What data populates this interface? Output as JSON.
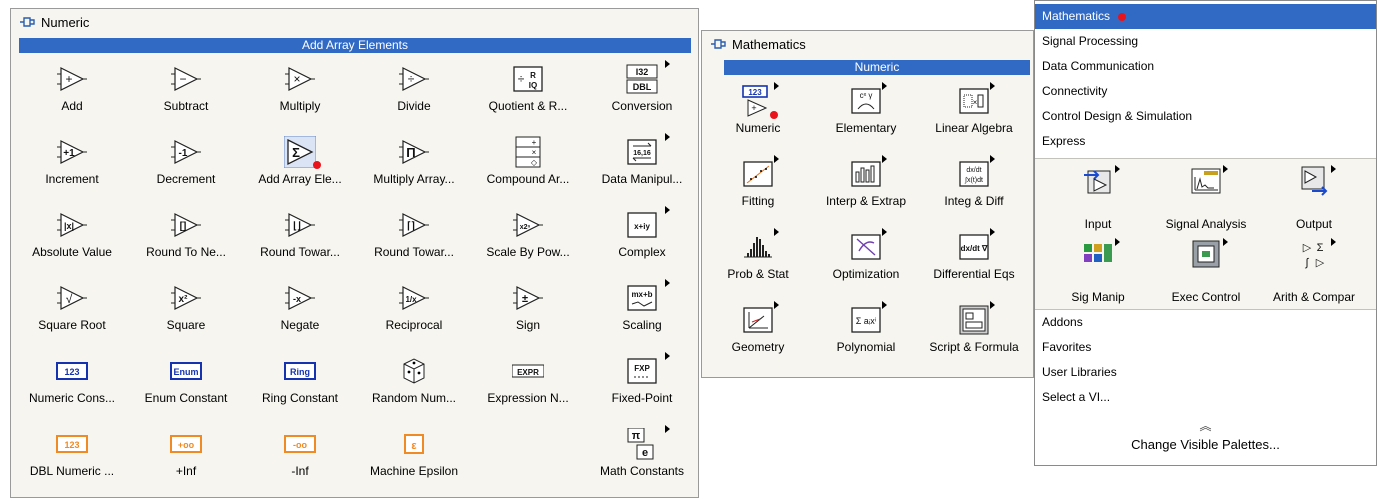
{
  "numeric_palette": {
    "title": "Numeric",
    "selected": "Add Array Elements",
    "items": [
      {
        "label": "Add",
        "icon": "add-icon"
      },
      {
        "label": "Subtract",
        "icon": "subtract-icon"
      },
      {
        "label": "Multiply",
        "icon": "multiply-icon"
      },
      {
        "label": "Divide",
        "icon": "divide-icon"
      },
      {
        "label": "Quotient & R...",
        "icon": "quotient-remainder-icon"
      },
      {
        "label": "Conversion",
        "icon": "conversion-icon"
      },
      {
        "label": "Increment",
        "icon": "increment-icon"
      },
      {
        "label": "Decrement",
        "icon": "decrement-icon"
      },
      {
        "label": "Add Array Ele...",
        "icon": "add-array-elements-icon"
      },
      {
        "label": "Multiply Array...",
        "icon": "multiply-array-icon"
      },
      {
        "label": "Compound Ar...",
        "icon": "compound-arithmetic-icon"
      },
      {
        "label": "Data Manipul...",
        "icon": "data-manipulation-icon"
      },
      {
        "label": "Absolute Value",
        "icon": "absolute-value-icon"
      },
      {
        "label": "Round To Ne...",
        "icon": "round-nearest-icon"
      },
      {
        "label": "Round Towar...",
        "icon": "round-down-icon"
      },
      {
        "label": "Round Towar...",
        "icon": "round-up-icon"
      },
      {
        "label": "Scale By Pow...",
        "icon": "scale-power-icon"
      },
      {
        "label": "Complex",
        "icon": "complex-icon"
      },
      {
        "label": "Square Root",
        "icon": "square-root-icon"
      },
      {
        "label": "Square",
        "icon": "square-icon"
      },
      {
        "label": "Negate",
        "icon": "negate-icon"
      },
      {
        "label": "Reciprocal",
        "icon": "reciprocal-icon"
      },
      {
        "label": "Sign",
        "icon": "sign-icon"
      },
      {
        "label": "Scaling",
        "icon": "scaling-icon"
      },
      {
        "label": "Numeric Cons...",
        "icon": "numeric-constant-icon"
      },
      {
        "label": "Enum Constant",
        "icon": "enum-constant-icon"
      },
      {
        "label": "Ring Constant",
        "icon": "ring-constant-icon"
      },
      {
        "label": "Random Num...",
        "icon": "random-number-icon"
      },
      {
        "label": "Expression N...",
        "icon": "expression-node-icon"
      },
      {
        "label": "Fixed-Point",
        "icon": "fixed-point-icon"
      },
      {
        "label": "DBL Numeric ...",
        "icon": "dbl-numeric-constant-icon"
      },
      {
        "label": "+Inf",
        "icon": "plus-inf-icon"
      },
      {
        "label": "-Inf",
        "icon": "minus-inf-icon"
      },
      {
        "label": "Machine Epsilon",
        "icon": "machine-epsilon-icon"
      },
      {
        "label": "",
        "icon": "empty"
      },
      {
        "label": "Math Constants",
        "icon": "math-constants-icon"
      }
    ],
    "icon_text": {
      "quotient": "R\nIQ",
      "conv_top": "I32",
      "conv_bot": "DBL",
      "manip": "16,16",
      "complex": "x+iy",
      "scaling_top": "mx+b",
      "numconst": "123",
      "enumconst": "Enum",
      "ringconst": "Ring",
      "expr": "EXPR",
      "fxp": "FXP",
      "dbl": "123",
      "pinf": "+oo",
      "minf": "-oo",
      "eps": "ε",
      "pi": "π",
      "e": "e"
    }
  },
  "math_palette": {
    "title": "Mathematics",
    "selected": "Numeric",
    "items": [
      {
        "label": "Numeric",
        "icon": "numeric-icon"
      },
      {
        "label": "Elementary",
        "icon": "elementary-icon"
      },
      {
        "label": "Linear Algebra",
        "icon": "linear-algebra-icon"
      },
      {
        "label": "Fitting",
        "icon": "fitting-icon"
      },
      {
        "label": "Interp & Extrap",
        "icon": "interp-extrap-icon"
      },
      {
        "label": "Integ & Diff",
        "icon": "integ-diff-icon"
      },
      {
        "label": "Prob & Stat",
        "icon": "prob-stat-icon"
      },
      {
        "label": "Optimization",
        "icon": "optimization-icon"
      },
      {
        "label": "Differential Eqs",
        "icon": "differential-eqs-icon"
      },
      {
        "label": "Geometry",
        "icon": "geometry-icon"
      },
      {
        "label": "Polynomial",
        "icon": "polynomial-icon"
      },
      {
        "label": "Script & Formula",
        "icon": "script-formula-icon"
      }
    ],
    "icon_text": {
      "numeric": "123",
      "elementary": "cˣ γ",
      "integ_top": "dx/dt",
      "integ_bot": "∫x(t)dt",
      "diffeq": "dx/dt ∇",
      "poly": "Σ aᵢxⁱ"
    }
  },
  "functions_menu": {
    "top_items": [
      {
        "label": "Mathematics",
        "selected": true
      },
      {
        "label": "Signal Processing"
      },
      {
        "label": "Data Communication"
      },
      {
        "label": "Connectivity"
      },
      {
        "label": "Control Design & Simulation"
      },
      {
        "label": "Express"
      }
    ],
    "express_items": [
      {
        "label": "Input",
        "icon": "input-icon"
      },
      {
        "label": "Signal Analysis",
        "icon": "signal-analysis-icon"
      },
      {
        "label": "Output",
        "icon": "output-icon"
      },
      {
        "label": "Sig Manip",
        "icon": "sig-manip-icon"
      },
      {
        "label": "Exec Control",
        "icon": "exec-control-icon"
      },
      {
        "label": "Arith & Compar",
        "icon": "arith-compar-icon"
      }
    ],
    "bottom_items": [
      {
        "label": "Addons"
      },
      {
        "label": "Favorites"
      },
      {
        "label": "User Libraries"
      },
      {
        "label": "Select a VI..."
      }
    ],
    "footer": "Change Visible Palettes...",
    "collapse_glyph": "≈"
  },
  "colors": {
    "selection": "#316ac5",
    "panel": "#f6f5ef",
    "accent_red": "#e8131b",
    "const_blue": "#1533b0",
    "const_orange": "#f08a24"
  }
}
